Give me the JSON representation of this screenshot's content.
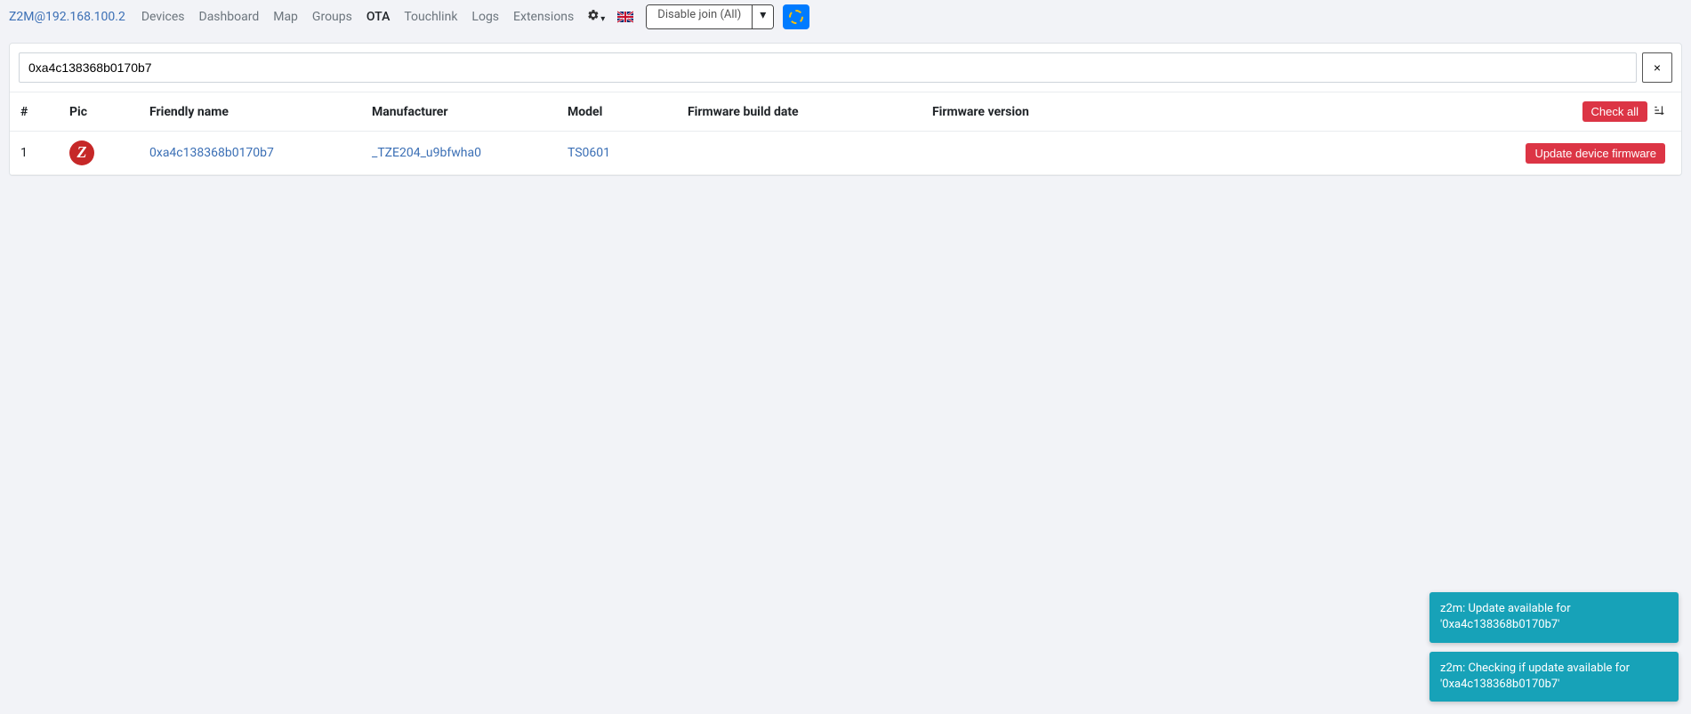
{
  "nav": {
    "brand": "Z2M@192.168.100.2",
    "links": [
      "Devices",
      "Dashboard",
      "Map",
      "Groups",
      "OTA",
      "Touchlink",
      "Logs",
      "Extensions"
    ],
    "active": "OTA",
    "disable_join": "Disable join (All)"
  },
  "search": {
    "value": "0xa4c138368b0170b7",
    "clear": "×"
  },
  "headers": {
    "index": "#",
    "pic": "Pic",
    "friendly": "Friendly name",
    "manufacturer": "Manufacturer",
    "model": "Model",
    "build": "Firmware build date",
    "fw": "Firmware version",
    "check_all": "Check all"
  },
  "rows": [
    {
      "index": "1",
      "friendly": "0xa4c138368b0170b7",
      "manufacturer": "_TZE204_u9bfwha0",
      "model": "TS0601",
      "build": "",
      "fw": "",
      "action": "Update device firmware"
    }
  ],
  "toasts": [
    "z2m: Update available for '0xa4c138368b0170b7'",
    "z2m: Checking if update available for '0xa4c138368b0170b7'"
  ]
}
